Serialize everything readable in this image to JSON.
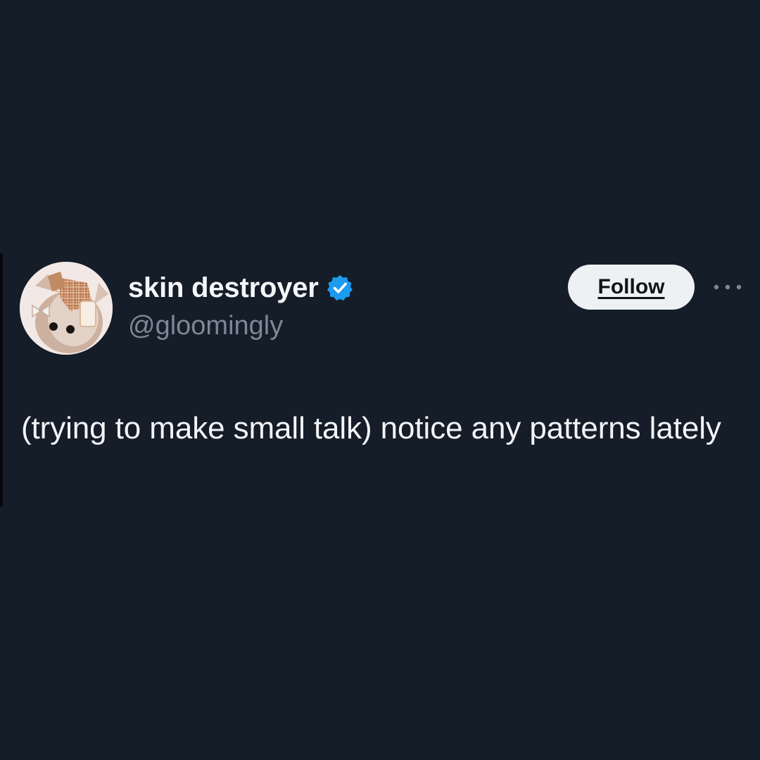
{
  "tweet": {
    "author": {
      "display_name": "skin destroyer",
      "handle": "@gloomingly",
      "verified": true,
      "avatar_icon": "avatar-icon"
    },
    "follow_label": "Follow",
    "more_icon": "more-horizontal-icon",
    "text": "(trying to make small talk) notice any patterns lately"
  },
  "colors": {
    "background": "#151d29",
    "verified_badge": "#1d9bf0",
    "follow_button_bg": "#eef1f4",
    "handle_text": "#7c8896",
    "body_text": "#f2f4f7"
  }
}
